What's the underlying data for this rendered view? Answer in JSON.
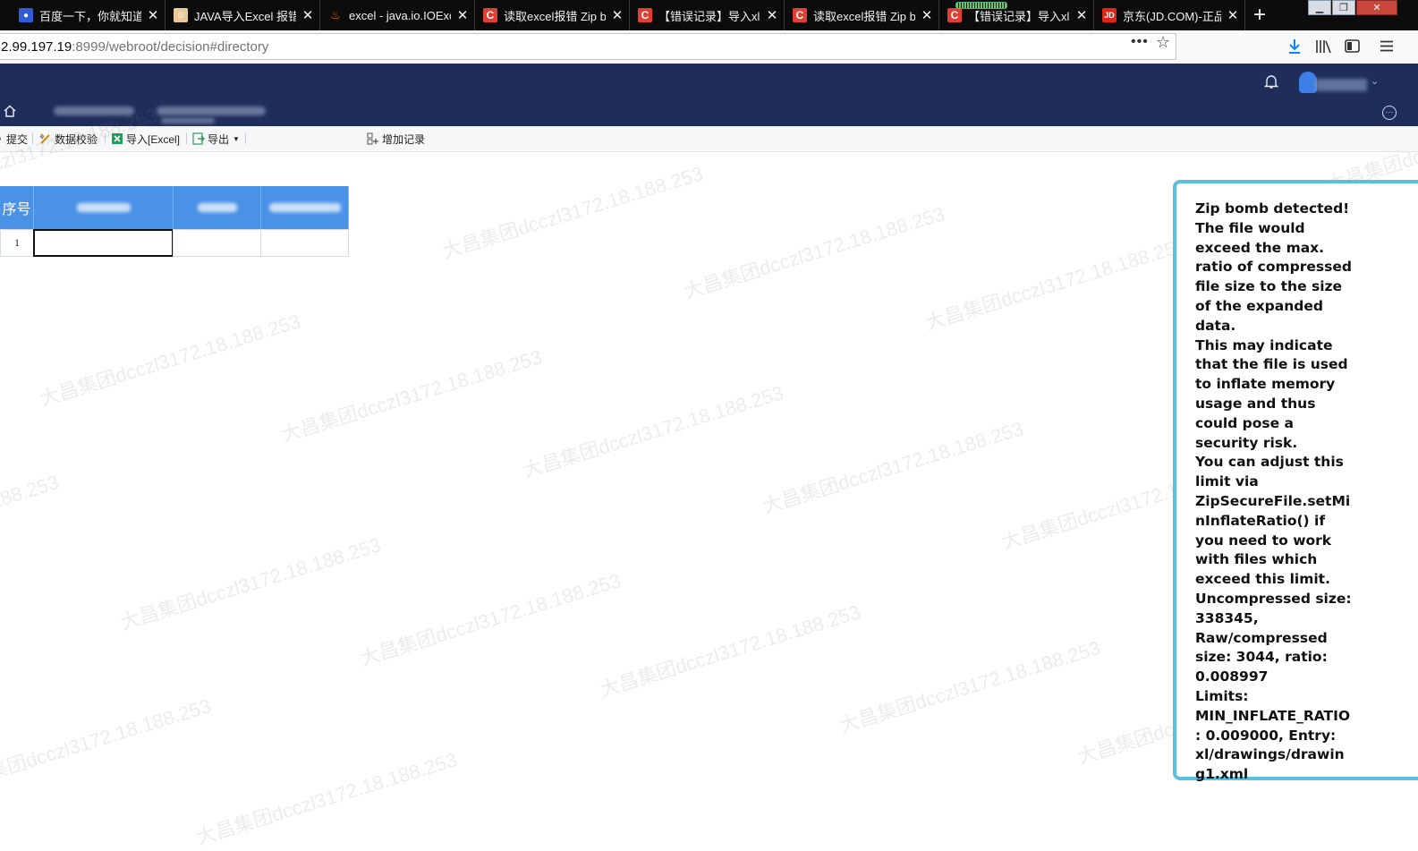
{
  "browser": {
    "tabs": [
      {
        "icon": "baidu-paw-icon",
        "label": "百度一下，你就知道"
      },
      {
        "icon": "user-avatar-icon",
        "label": "JAVA导入Excel 报错"
      },
      {
        "icon": "java-cup-icon",
        "label": "excel - java.io.IOExc"
      },
      {
        "icon": "csdn-icon",
        "label": "读取excel报错 Zip bo"
      },
      {
        "icon": "csdn-icon",
        "label": "【错误记录】导入xlsx"
      },
      {
        "icon": "csdn-icon",
        "label": "读取excel报错 Zip bo"
      },
      {
        "icon": "csdn-icon",
        "label": "【错误记录】导入xlsx"
      },
      {
        "icon": "jd-icon",
        "label": "京东(JD.COM)-正品"
      }
    ],
    "new_tab": "+",
    "url_host": "2.99.197.19",
    "url_path": ":8999/webroot/decision#directory"
  },
  "toolbar": {
    "submit": "提交",
    "validate": "数据校验",
    "import_excel": "导入[Excel]",
    "export": "导出",
    "add_record": "增加记录"
  },
  "grid": {
    "index_header": "序号",
    "row_index": "1"
  },
  "watermark": "大昌集团dcczl3172.18.188.253",
  "error": {
    "lines": [
      "Zip bomb detected!",
      "The file would exceed the max. ratio of compressed file size to the size of the expanded data.",
      "This may indicate that the file is used to inflate memory usage and thus could pose a security risk.",
      "You can adjust this limit via ZipSecureFile.setMinInflateRatio() if you need to work with files which exceed this limit.",
      "Uncompressed size: 338345, Raw/compressed size: 3044, ratio: 0.008997",
      "Limits: MIN_INFLATE_RATIO: 0.009000, Entry: xl/drawings/drawing1.xml"
    ],
    "border_color": "#5bc0de"
  },
  "colors": {
    "app_header": "#1e2d5a",
    "grid_header": "#4a92e6"
  }
}
